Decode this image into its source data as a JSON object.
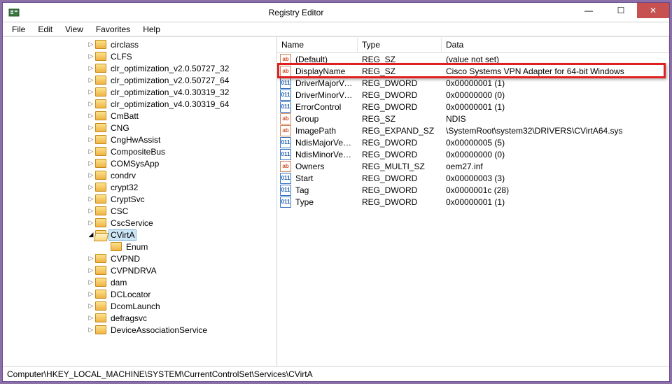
{
  "title": "Registry Editor",
  "menu": [
    "File",
    "Edit",
    "View",
    "Favorites",
    "Help"
  ],
  "tree": [
    {
      "indent": 2,
      "label": "circlass"
    },
    {
      "indent": 2,
      "label": "CLFS"
    },
    {
      "indent": 2,
      "label": "clr_optimization_v2.0.50727_32"
    },
    {
      "indent": 2,
      "label": "clr_optimization_v2.0.50727_64"
    },
    {
      "indent": 2,
      "label": "clr_optimization_v4.0.30319_32"
    },
    {
      "indent": 2,
      "label": "clr_optimization_v4.0.30319_64"
    },
    {
      "indent": 2,
      "label": "CmBatt"
    },
    {
      "indent": 2,
      "label": "CNG"
    },
    {
      "indent": 2,
      "label": "CngHwAssist"
    },
    {
      "indent": 2,
      "label": "CompositeBus"
    },
    {
      "indent": 2,
      "label": "COMSysApp"
    },
    {
      "indent": 2,
      "label": "condrv"
    },
    {
      "indent": 2,
      "label": "crypt32"
    },
    {
      "indent": 2,
      "label": "CryptSvc"
    },
    {
      "indent": 2,
      "label": "CSC"
    },
    {
      "indent": 2,
      "label": "CscService"
    },
    {
      "indent": 2,
      "label": "CVirtA",
      "selected": true,
      "open": true
    },
    {
      "indent": 3,
      "label": "Enum",
      "leaf": true
    },
    {
      "indent": 2,
      "label": "CVPND"
    },
    {
      "indent": 2,
      "label": "CVPNDRVA"
    },
    {
      "indent": 2,
      "label": "dam"
    },
    {
      "indent": 2,
      "label": "DCLocator"
    },
    {
      "indent": 2,
      "label": "DcomLaunch"
    },
    {
      "indent": 2,
      "label": "defragsvc"
    },
    {
      "indent": 2,
      "label": "DeviceAssociationService"
    }
  ],
  "columns": {
    "name": "Name",
    "type": "Type",
    "data": "Data"
  },
  "values": [
    {
      "icon": "sz",
      "name": "(Default)",
      "type": "REG_SZ",
      "data": "(value not set)"
    },
    {
      "icon": "sz",
      "name": "DisplayName",
      "type": "REG_SZ",
      "data": "Cisco Systems VPN Adapter for 64-bit Windows",
      "highlight": true
    },
    {
      "icon": "dw",
      "name": "DriverMajorVersi...",
      "type": "REG_DWORD",
      "data": "0x00000001 (1)"
    },
    {
      "icon": "dw",
      "name": "DriverMinorVers...",
      "type": "REG_DWORD",
      "data": "0x00000000 (0)"
    },
    {
      "icon": "dw",
      "name": "ErrorControl",
      "type": "REG_DWORD",
      "data": "0x00000001 (1)"
    },
    {
      "icon": "sz",
      "name": "Group",
      "type": "REG_SZ",
      "data": "NDIS"
    },
    {
      "icon": "sz",
      "name": "ImagePath",
      "type": "REG_EXPAND_SZ",
      "data": "\\SystemRoot\\system32\\DRIVERS\\CVirtA64.sys"
    },
    {
      "icon": "dw",
      "name": "NdisMajorVersion",
      "type": "REG_DWORD",
      "data": "0x00000005 (5)"
    },
    {
      "icon": "dw",
      "name": "NdisMinorVersion",
      "type": "REG_DWORD",
      "data": "0x00000000 (0)"
    },
    {
      "icon": "sz",
      "name": "Owners",
      "type": "REG_MULTI_SZ",
      "data": "oem27.inf"
    },
    {
      "icon": "dw",
      "name": "Start",
      "type": "REG_DWORD",
      "data": "0x00000003 (3)"
    },
    {
      "icon": "dw",
      "name": "Tag",
      "type": "REG_DWORD",
      "data": "0x0000001c (28)"
    },
    {
      "icon": "dw",
      "name": "Type",
      "type": "REG_DWORD",
      "data": "0x00000001 (1)"
    }
  ],
  "statusbar": "Computer\\HKEY_LOCAL_MACHINE\\SYSTEM\\CurrentControlSet\\Services\\CVirtA"
}
